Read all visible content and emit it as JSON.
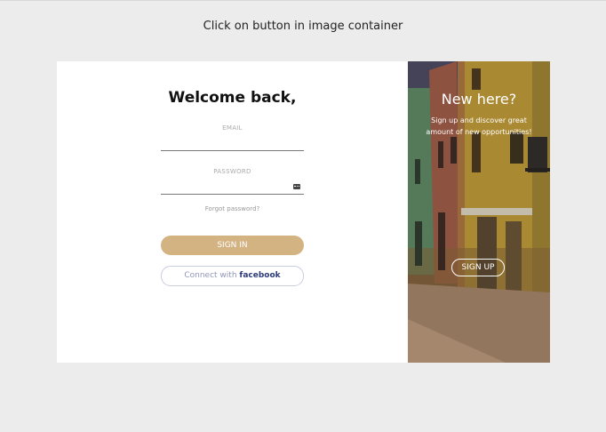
{
  "instruction": "Click on button in image container",
  "login": {
    "title": "Welcome back,",
    "email_label": "EMAIL",
    "email_value": "",
    "password_label": "PASSWORD",
    "password_value": "",
    "forgot": "Forgot password?",
    "signin": "SIGN IN",
    "connect_prefix": "Connect with",
    "connect_brand": "facebook",
    "password_icon": "key-icon"
  },
  "promo": {
    "title": "New here?",
    "text": "Sign up and discover great amount of new opportunities!",
    "signup": "SIGN UP"
  },
  "colors": {
    "page_bg": "#ececec",
    "signin_bg": "#d4b383",
    "facebook_brand": "#2c3a78"
  }
}
